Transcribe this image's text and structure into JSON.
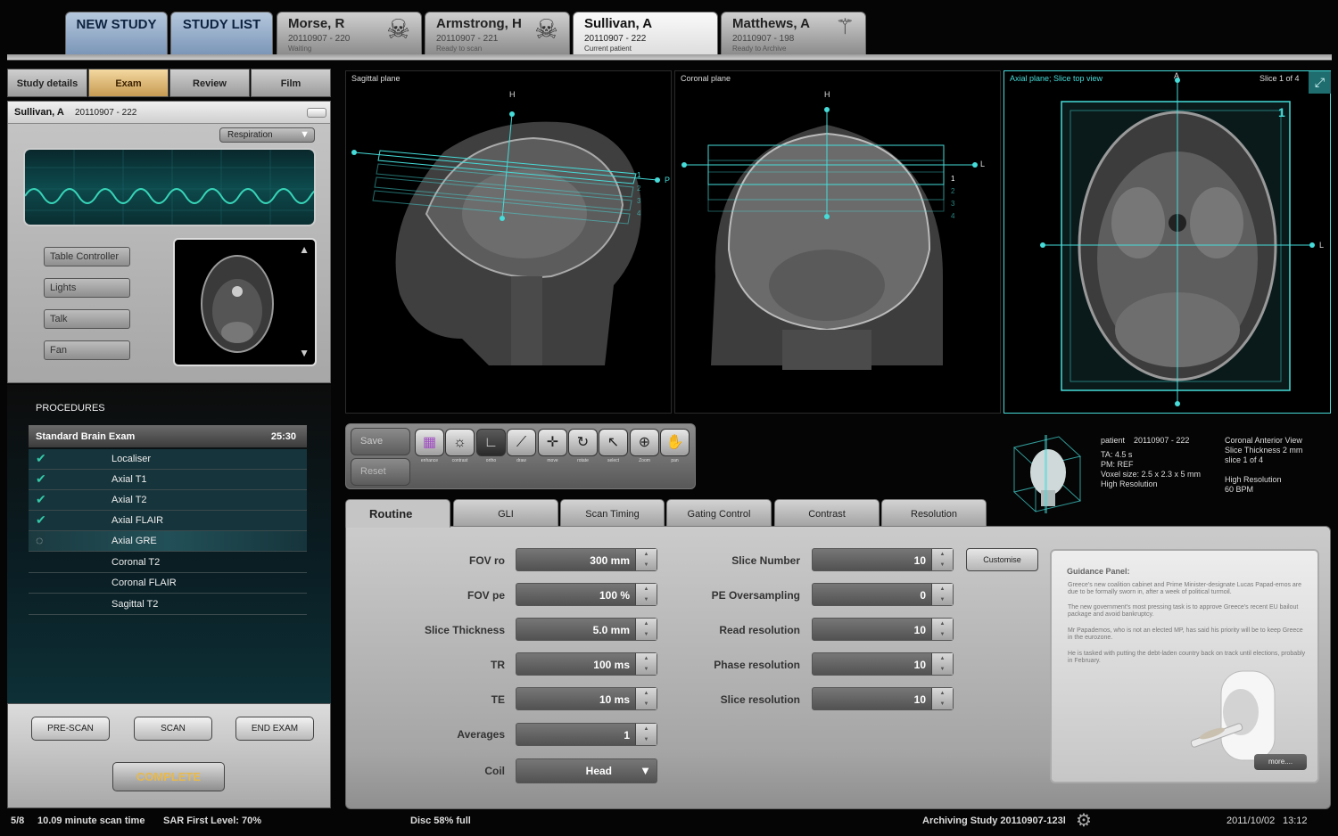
{
  "top_tabs": {
    "new_study": "NEW STUDY",
    "study_list": "STUDY LIST",
    "patients": [
      {
        "name": "Morse, R",
        "id": "20110907 - 220",
        "status": "Waiting",
        "icon": "skull-icon"
      },
      {
        "name": "Armstrong, H",
        "id": "20110907 - 221",
        "status": "Ready to scan",
        "icon": "skull-icon"
      },
      {
        "name": "Sullivan, A",
        "id": "20110907 - 222",
        "status": "Current patient",
        "icon": "none"
      },
      {
        "name": "Matthews, A",
        "id": "20110907 - 198",
        "status": "Ready to Archive",
        "icon": "spine-icon"
      }
    ]
  },
  "left_tabs": [
    "Study details",
    "Exam",
    "Review",
    "Film"
  ],
  "patient_header": {
    "name": "Sullivan, A",
    "id": "20110907 - 222"
  },
  "respiration_select": "Respiration",
  "controls": [
    "Table Controller",
    "Lights",
    "Talk",
    "Fan"
  ],
  "procedures": {
    "heading": "PROCEDURES",
    "exam_name": "Standard Brain Exam",
    "exam_time": "25:30",
    "items": [
      {
        "label": "Localiser",
        "state": "done"
      },
      {
        "label": "Axial T1",
        "state": "done"
      },
      {
        "label": "Axial T2",
        "state": "done"
      },
      {
        "label": "Axial FLAIR",
        "state": "done"
      },
      {
        "label": "Axial GRE",
        "state": "in-progress"
      },
      {
        "label": "Coronal T2",
        "state": "pending"
      },
      {
        "label": "Coronal FLAIR",
        "state": "pending"
      },
      {
        "label": "Sagittal T2",
        "state": "pending"
      }
    ]
  },
  "action_buttons": {
    "prescan": "PRE-SCAN",
    "scan": "SCAN",
    "end_exam": "END EXAM",
    "complete": "COMPLETE"
  },
  "viewports": {
    "sagittal": {
      "title": "Sagittal plane",
      "h": "H",
      "p": "P",
      "slices": [
        "1",
        "2",
        "3",
        "4"
      ]
    },
    "coronal": {
      "title": "Coronal plane",
      "h": "H",
      "l": "L",
      "slices": [
        "1",
        "2",
        "3",
        "4"
      ]
    },
    "axial": {
      "title": "Axial plane; Slice top view",
      "slice_info": "Slice 1 of 4",
      "a": "A",
      "l": "L",
      "slice_number": "1"
    }
  },
  "toolbar": {
    "save": "Save",
    "reset": "Reset",
    "tools": [
      {
        "name": "enhance",
        "icon": "enhance-icon",
        "glyph": "▦"
      },
      {
        "name": "contrast",
        "icon": "contrast-icon",
        "glyph": "☼"
      },
      {
        "name": "ortho",
        "icon": "ortho-icon",
        "glyph": "∟"
      },
      {
        "name": "draw",
        "icon": "draw-icon",
        "glyph": "⟋"
      },
      {
        "name": "move",
        "icon": "move-icon",
        "glyph": "✛"
      },
      {
        "name": "rotate",
        "icon": "rotate-icon",
        "glyph": "↻"
      },
      {
        "name": "select",
        "icon": "select-icon",
        "glyph": "↖"
      },
      {
        "name": "Zoom",
        "icon": "zoom-icon",
        "glyph": "⊕"
      },
      {
        "name": "pan",
        "icon": "pan-icon",
        "glyph": "✋"
      }
    ]
  },
  "info": {
    "patient_label": "patient",
    "patient_id": "20110907 - 222",
    "ta": "TA: 4.5 s",
    "pm": "PM: REF",
    "voxel": "Voxel size: 2.5 x 2.3 x 5 mm",
    "resolution": "High Resolution",
    "view": "Coronal Anterior View",
    "slice_thickness": "Slice Thickness 2 mm",
    "slice": "slice 1 of 4",
    "resolution2": "High Resolution",
    "bpm": "60 BPM"
  },
  "settings_tabs": [
    "Routine",
    "GLI",
    "Scan Timing",
    "Gating Control",
    "Contrast",
    "Resolution"
  ],
  "params_left": [
    {
      "label": "FOV  ro",
      "value": "300 mm"
    },
    {
      "label": "FOV  pe",
      "value": "100  %"
    },
    {
      "label": "Slice Thickness",
      "value": "5.0  mm"
    },
    {
      "label": "TR",
      "value": "100  ms"
    },
    {
      "label": "TE",
      "value": "10  ms"
    },
    {
      "label": "Averages",
      "value": "1"
    }
  ],
  "coil": {
    "label": "Coil",
    "value": "Head"
  },
  "params_right": [
    {
      "label": "Slice Number",
      "value": "10"
    },
    {
      "label": "PE Oversampling",
      "value": "0"
    },
    {
      "label": "Read resolution",
      "value": "10"
    },
    {
      "label": "Phase resolution",
      "value": "10"
    },
    {
      "label": "Slice resolution",
      "value": "10"
    }
  ],
  "customise": "Customise",
  "guidance": {
    "title": "Guidance Panel:",
    "paragraphs": [
      "Greece's new coalition cabinet and Prime Minister-designate Lucas Papad-emos are due to be formally sworn in, after a week of political turmoil.",
      "The new government's most pressing task is to approve Greece's recent EU bailout package and avoid bankruptcy.",
      "Mr Papademos, who is not an elected MP, has said his priority will be to keep Greece in the eurozone.",
      "He is tasked with putting the debt-laden country back on track until elections, probably in February."
    ],
    "more": "more...."
  },
  "status_bar": {
    "count": "5/8",
    "scan_time": "10.09 minute scan time",
    "sar": "SAR First Level: 70%",
    "disc": "Disc 58% full",
    "archiving": "Archiving Study 20110907-123l",
    "date": "2011/10/02",
    "time": "13:12"
  }
}
